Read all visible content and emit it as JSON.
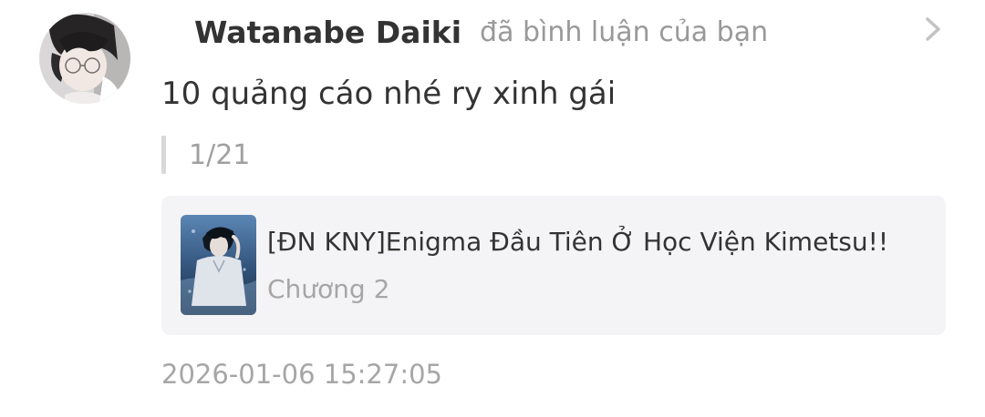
{
  "notification": {
    "user_name": "Watanabe Daiki",
    "action_text": "đã bình luận của bạn",
    "comment_text": "10 quảng cáo nhé ry xinh gái",
    "quote_text": "1/21",
    "timestamp": "2026-01-06 15:27:05"
  },
  "story": {
    "title": "[ĐN KNY]Enigma Đầu Tiên Ở Học Viện Kimetsu!!",
    "chapter": "Chương 2"
  },
  "icons": {
    "avatar": "user-avatar",
    "cover": "story-cover-image",
    "chevron": "chevron-right-icon"
  },
  "colors": {
    "primary_text": "#333333",
    "secondary_text": "#999999",
    "card_background": "#f4f4f6",
    "quote_bar": "#d8d8d8"
  }
}
